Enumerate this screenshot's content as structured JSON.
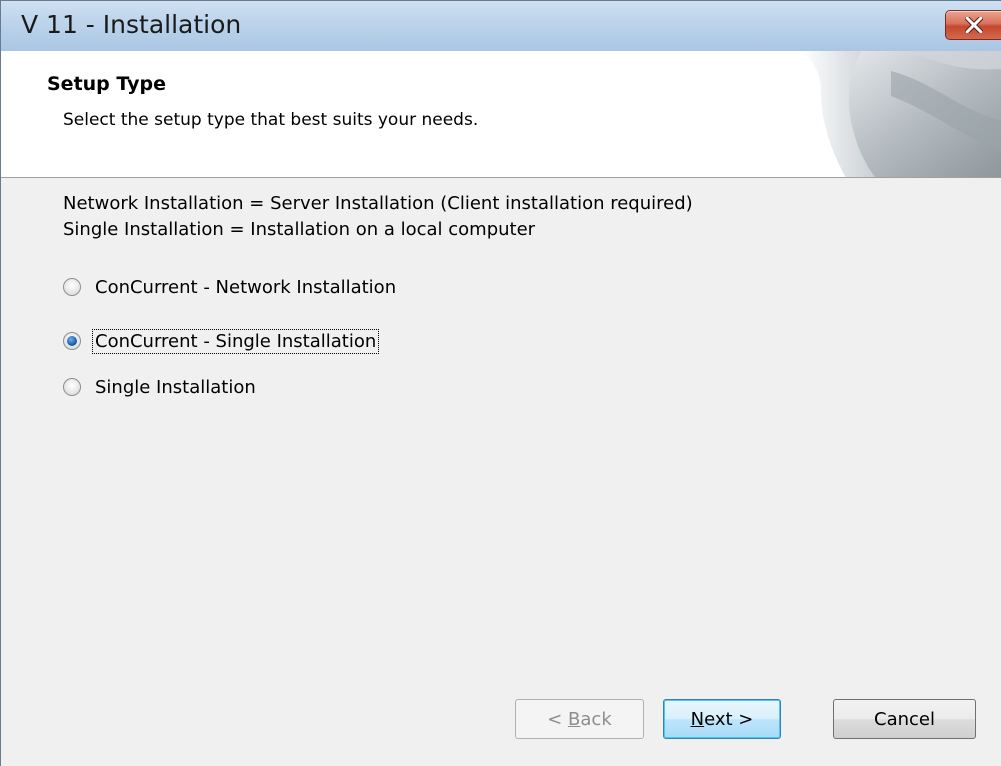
{
  "window": {
    "title": "V 11 - Installation"
  },
  "header": {
    "title": "Setup Type",
    "subtitle": "Select the setup type that best suits your needs."
  },
  "body": {
    "info_line_1": "Network Installation = Server Installation (Client installation required)",
    "info_line_2": "Single Installation = Installation on a local computer"
  },
  "options": [
    {
      "label": "ConCurrent - Network Installation",
      "selected": false
    },
    {
      "label": "ConCurrent - Single Installation",
      "selected": true
    },
    {
      "label": "Single Installation",
      "selected": false
    }
  ],
  "buttons": {
    "back": {
      "prefix": "< ",
      "accel": "B",
      "rest": "ack",
      "enabled": false
    },
    "next": {
      "accel": "N",
      "rest": "ext >",
      "enabled": true
    },
    "cancel": {
      "label": "Cancel",
      "enabled": true
    }
  },
  "icons": {
    "close": "close-icon",
    "header_art": "page-curl-icon"
  },
  "colors": {
    "titlebar": "#bcd3eb",
    "close_button": "#c4482f",
    "radio_selected": "#1b5fae",
    "default_button_border": "#3c7fb1"
  }
}
